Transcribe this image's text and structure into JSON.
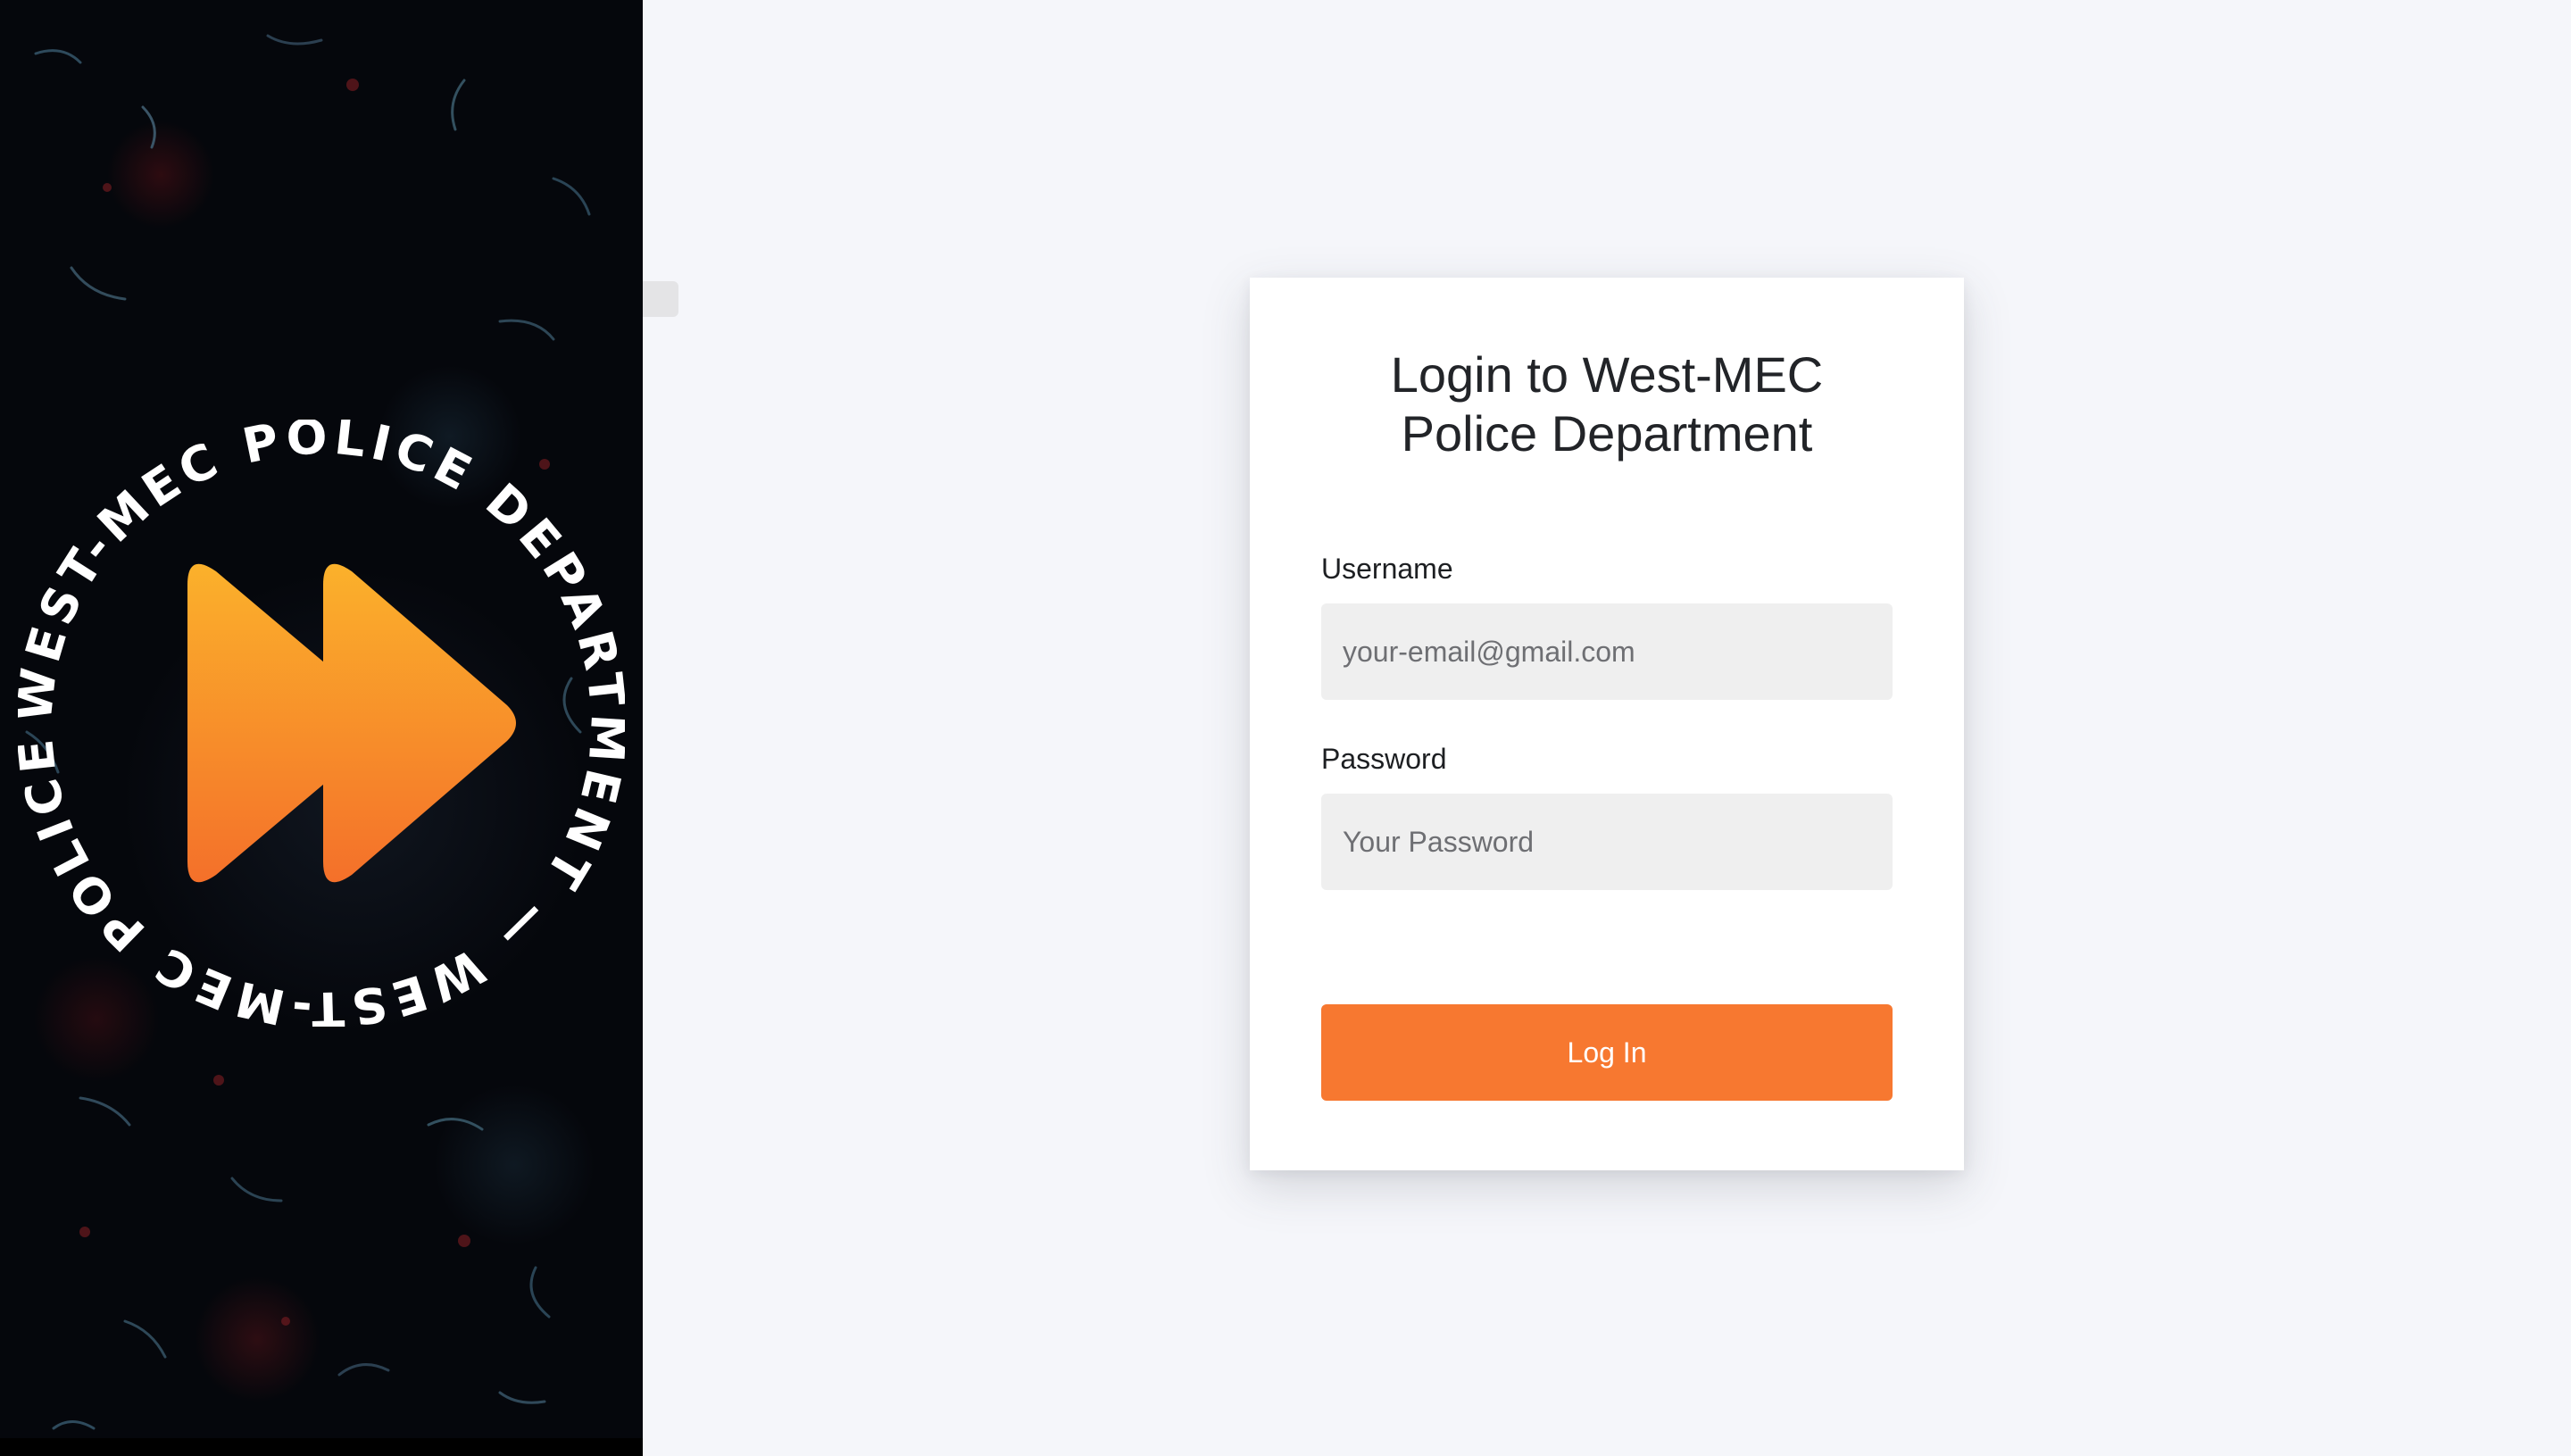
{
  "brand": {
    "badge_text": "WEST-MEC POLICE DEPARTMENT — WEST-MEC POLICE DEPARTMENT —",
    "icon": "fast-forward-icon",
    "colors": {
      "panel_bg": "#05070c",
      "icon_top": "#fbb12b",
      "icon_bottom": "#f4702a",
      "badge_text": "#ffffff"
    }
  },
  "login": {
    "title_prefix": "Login to ",
    "title_org": "West-MEC",
    "title_line2": "Police Department",
    "username_label": "Username",
    "username_placeholder": "your-email@gmail.com",
    "username_value": "",
    "password_label": "Password",
    "password_placeholder": "Your Password",
    "password_value": "",
    "submit_label": "Log In",
    "accent_color": "#f77830"
  }
}
